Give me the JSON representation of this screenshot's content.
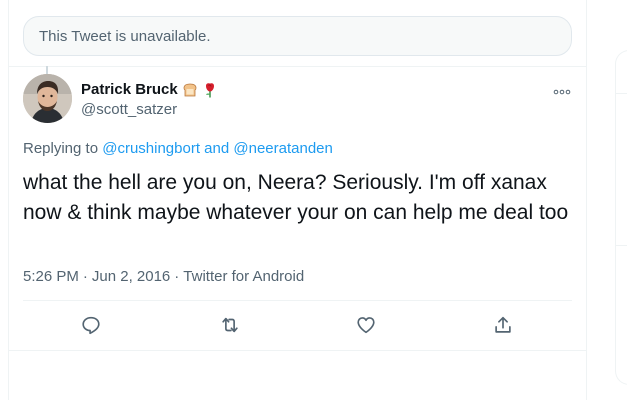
{
  "unavailable_notice": "This Tweet is unavailable.",
  "author": {
    "display_name": "Patrick Bruck",
    "handle": "@scott_satzer",
    "badges": [
      "bread-emoji",
      "rose-emoji"
    ]
  },
  "replying": {
    "prefix": "Replying to",
    "mention1": "@crushingbort",
    "conjunction": "and",
    "mention2": "@neeratanden"
  },
  "tweet": {
    "text": "what the hell are you on, Neera? Seriously. I'm off xanax now & think maybe whatever your on can help me deal too"
  },
  "meta": {
    "time": "5:26 PM",
    "dot1": "·",
    "date": "Jun 2, 2016",
    "dot2": "·",
    "source": "Twitter for Android"
  },
  "actions": [
    "reply-icon",
    "retweet-icon",
    "like-icon",
    "share-icon"
  ],
  "colors": {
    "accent": "#1d9bf0",
    "secondary_text": "#536471",
    "icon": "#536471",
    "border": "#eff3f4"
  }
}
